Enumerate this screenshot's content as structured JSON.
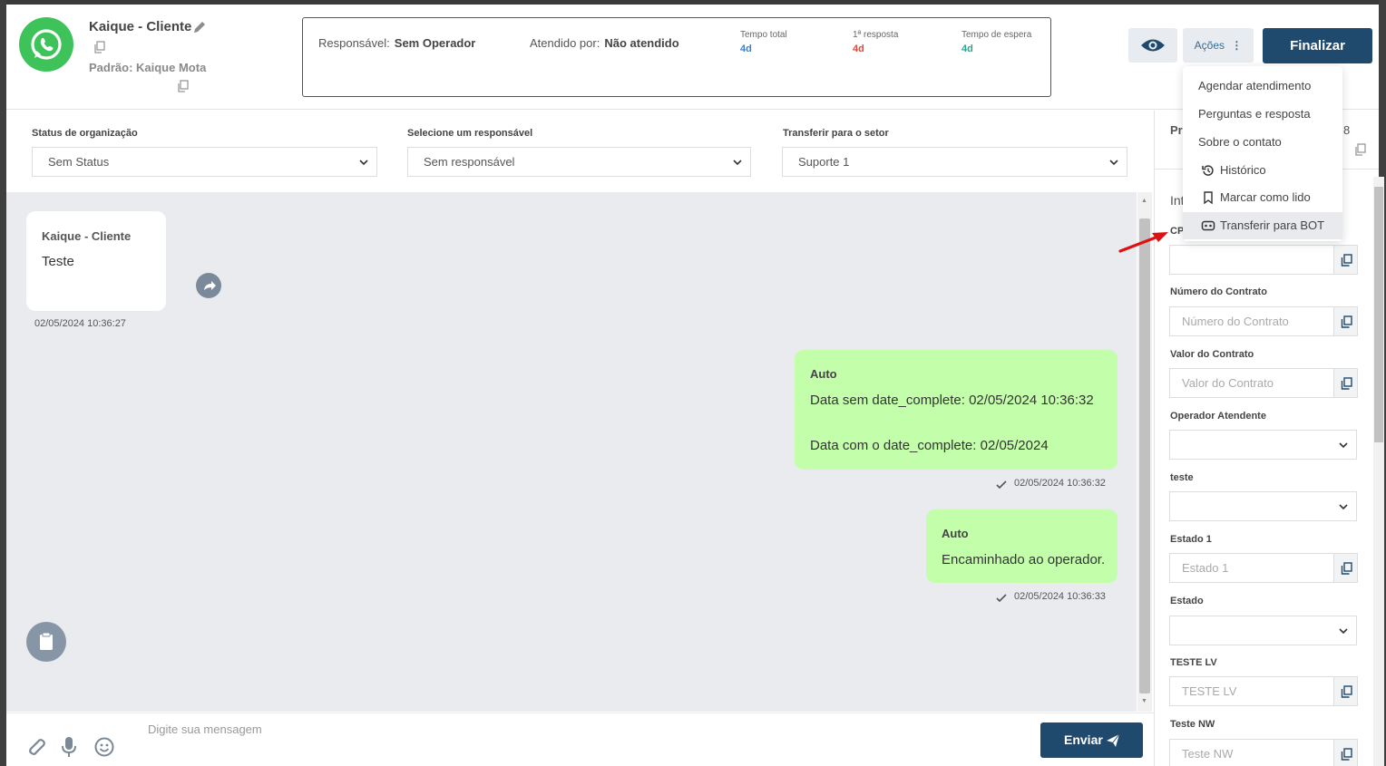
{
  "header": {
    "contact_name": "Kaique - Cliente",
    "default_line": "Padrão: Kaique Mota",
    "responsavel_label": "Responsável:",
    "responsavel_value": "Sem Operador",
    "atendido_label": "Atendido por:",
    "atendido_value": "Não atendido",
    "tempo_total_label": "Tempo total",
    "tempo_total_value": "4d",
    "primeira_resposta_label": "1ª resposta",
    "primeira_resposta_value": "4d",
    "tempo_espera_label": "Tempo de espera",
    "tempo_espera_value": "4d",
    "acoes_label": "Ações",
    "finalizar_label": "Finalizar"
  },
  "colors": {
    "tempo_total": "#3b7fc4",
    "primeira_resposta": "#e0463a",
    "tempo_espera": "#2aa58f",
    "primary": "#1f4a6d",
    "whatsapp": "#3ec35b",
    "outgoing_bubble": "#c3ffaa"
  },
  "actions_menu": {
    "items": [
      {
        "label": "Agendar atendimento",
        "icon": ""
      },
      {
        "label": "Perguntas e resposta",
        "icon": ""
      },
      {
        "label": "Sobre o contato",
        "icon": ""
      },
      {
        "label": "Histórico",
        "icon": "history-icon"
      },
      {
        "label": "Marcar como lido",
        "icon": "bookmark-icon"
      },
      {
        "label": "Transferir para BOT",
        "icon": "robot-icon"
      }
    ]
  },
  "filters": {
    "status_label": "Status de organização",
    "status_value": "Sem Status",
    "responsavel_label": "Selecione um responsável",
    "responsavel_value": "Sem responsável",
    "setor_label": "Transferir para o setor",
    "setor_value": "Suporte 1"
  },
  "messages": [
    {
      "direction": "in",
      "author": "Kaique - Cliente",
      "text": "Teste",
      "time": "02/05/2024 10:36:27"
    },
    {
      "direction": "out",
      "author": "Auto",
      "line1": "Data sem date_complete: 02/05/2024 10:36:32",
      "line2": "Data com o date_complete: 02/05/2024",
      "time": "02/05/2024 10:36:32"
    },
    {
      "direction": "out",
      "author": "Auto",
      "text": "Encaminhado ao operador.",
      "time": "02/05/2024 10:36:33"
    }
  ],
  "composer": {
    "placeholder": "Digite sua mensagem",
    "send_label": "Enviar"
  },
  "right_panel": {
    "partial_title_1": "Pr",
    "partial_number": "8",
    "partial_title_2": "Int",
    "partial_cpf": "CP",
    "fields": [
      {
        "label": "Número do Contrato",
        "placeholder": "Número do Contrato",
        "type": "input"
      },
      {
        "label": "Valor do Contrato",
        "placeholder": "Valor do Contrato",
        "type": "input"
      },
      {
        "label": "Operador Atendente",
        "type": "select"
      },
      {
        "label": "teste",
        "type": "select"
      },
      {
        "label": "Estado 1",
        "placeholder": "Estado 1",
        "type": "input"
      },
      {
        "label": "Estado",
        "type": "select"
      },
      {
        "label": "TESTE LV",
        "placeholder": "TESTE LV",
        "type": "input"
      },
      {
        "label": "Teste NW",
        "placeholder": "Teste NW",
        "type": "input"
      }
    ]
  }
}
